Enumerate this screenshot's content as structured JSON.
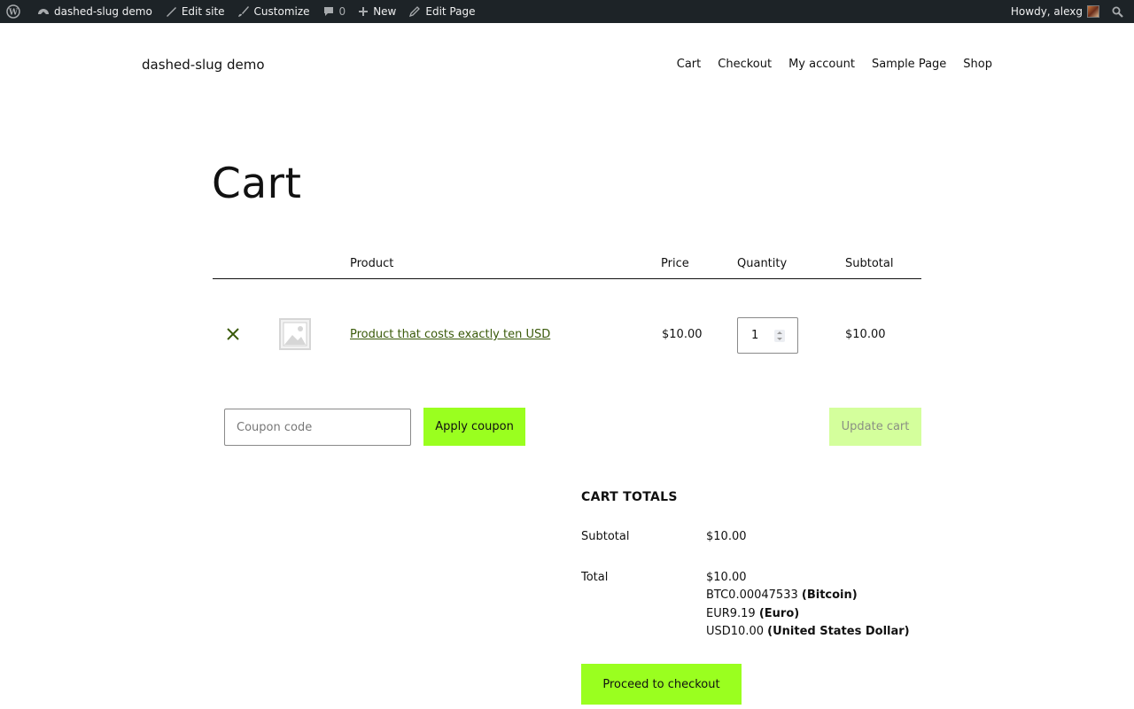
{
  "adminbar": {
    "site_name": "dashed-slug demo",
    "edit_site": "Edit site",
    "customize": "Customize",
    "comments_count": "0",
    "new": "New",
    "edit_page": "Edit Page",
    "howdy": "Howdy, alexg"
  },
  "header": {
    "site_title": "dashed-slug demo",
    "nav": [
      "Cart",
      "Checkout",
      "My account",
      "Sample Page",
      "Shop"
    ]
  },
  "page": {
    "title": "Cart"
  },
  "cart": {
    "columns": {
      "product": "Product",
      "price": "Price",
      "quantity": "Quantity",
      "subtotal": "Subtotal"
    },
    "items": [
      {
        "name": "Product that costs exactly ten USD",
        "price": "$10.00",
        "quantity": "1",
        "subtotal": "$10.00"
      }
    ],
    "coupon_placeholder": "Coupon code",
    "apply_coupon": "Apply coupon",
    "update_cart": "Update cart"
  },
  "totals": {
    "title": "CART TOTALS",
    "subtotal_label": "Subtotal",
    "subtotal_value": "$10.00",
    "total_label": "Total",
    "total_value": "$10.00",
    "conversions": [
      {
        "amount": "BTC0.00047533",
        "currency": "(Bitcoin)"
      },
      {
        "amount": "EUR9.19",
        "currency": "(Euro)"
      },
      {
        "amount": "USD10.00",
        "currency": "(United States Dollar)"
      }
    ],
    "checkout": "Proceed to checkout"
  },
  "colors": {
    "adminbar_bg": "#1d2327",
    "accent": "#9aff1f",
    "accent_disabled": "#d4ff9c",
    "link": "#3a5a0a"
  }
}
